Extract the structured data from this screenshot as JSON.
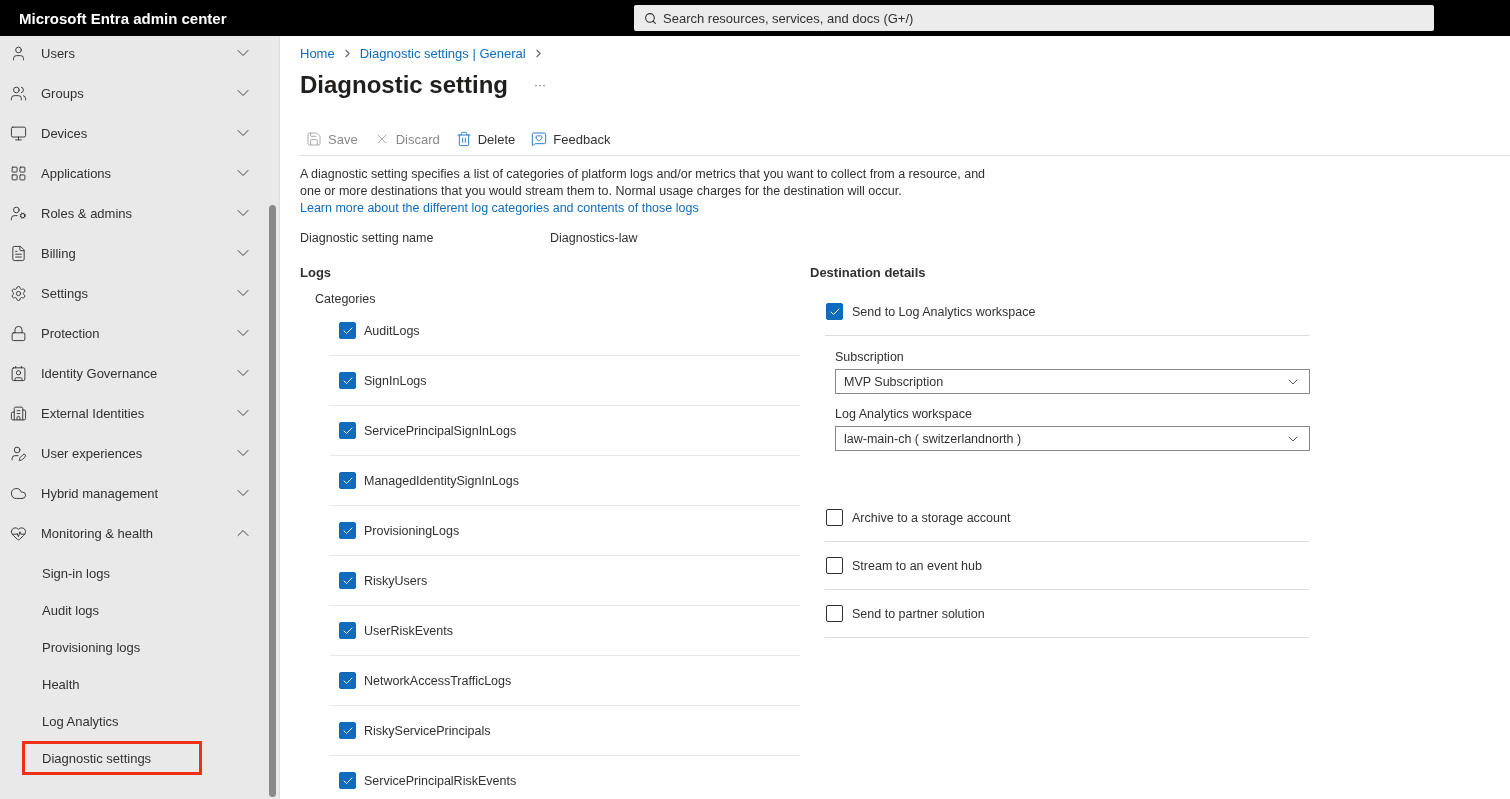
{
  "header": {
    "title": "Microsoft Entra admin center",
    "search": {
      "placeholder": "Search resources, services, and docs (G+/)"
    }
  },
  "sidebar": {
    "items": [
      {
        "label": "Users",
        "expanded": false
      },
      {
        "label": "Groups",
        "expanded": false
      },
      {
        "label": "Devices",
        "expanded": false
      },
      {
        "label": "Applications",
        "expanded": false
      },
      {
        "label": "Roles & admins",
        "expanded": false
      },
      {
        "label": "Billing",
        "expanded": false
      },
      {
        "label": "Settings",
        "expanded": false
      },
      {
        "label": "Protection",
        "expanded": false
      },
      {
        "label": "Identity Governance",
        "expanded": false
      },
      {
        "label": "External Identities",
        "expanded": false
      },
      {
        "label": "User experiences",
        "expanded": false
      },
      {
        "label": "Hybrid management",
        "expanded": false
      },
      {
        "label": "Monitoring & health",
        "expanded": true,
        "children": [
          {
            "label": "Sign-in logs",
            "selected": false
          },
          {
            "label": "Audit logs",
            "selected": false
          },
          {
            "label": "Provisioning logs",
            "selected": false
          },
          {
            "label": "Health",
            "selected": false
          },
          {
            "label": "Log Analytics",
            "selected": false
          },
          {
            "label": "Diagnostic settings",
            "selected": true
          }
        ]
      }
    ]
  },
  "breadcrumb": [
    "Home",
    "Diagnostic settings | General"
  ],
  "page_title": "Diagnostic setting",
  "more": "···",
  "toolbar": [
    {
      "label": "Save",
      "disabled": true
    },
    {
      "label": "Discard",
      "disabled": true
    },
    {
      "label": "Delete",
      "disabled": false
    },
    {
      "label": "Feedback",
      "disabled": false
    }
  ],
  "description": {
    "text": "A diagnostic setting specifies a list of categories of platform logs and/or metrics that you want to collect from a resource, and one or more destinations that you would stream them to. Normal usage charges for the destination will occur.",
    "link": "Learn more about the different log categories and contents of those logs"
  },
  "name_field": {
    "label": "Diagnostic setting name",
    "value": "Diagnostics-law"
  },
  "logs": {
    "title": "Logs",
    "subtitle": "Categories",
    "categories": [
      {
        "label": "AuditLogs",
        "checked": true
      },
      {
        "label": "SignInLogs",
        "checked": true
      },
      {
        "label": "ServicePrincipalSignInLogs",
        "checked": true
      },
      {
        "label": "ManagedIdentitySignInLogs",
        "checked": true
      },
      {
        "label": "ProvisioningLogs",
        "checked": true
      },
      {
        "label": "RiskyUsers",
        "checked": true
      },
      {
        "label": "UserRiskEvents",
        "checked": true
      },
      {
        "label": "NetworkAccessTrafficLogs",
        "checked": true
      },
      {
        "label": "RiskyServicePrincipals",
        "checked": true
      },
      {
        "label": "ServicePrincipalRiskEvents",
        "checked": true
      }
    ]
  },
  "destination": {
    "title": "Destination details",
    "options": [
      {
        "label": "Send to Log Analytics workspace",
        "checked": true,
        "fields": [
          {
            "label": "Subscription",
            "value": "MVP Subscription"
          },
          {
            "label": "Log Analytics workspace",
            "value": "law-main-ch ( switzerlandnorth )"
          }
        ]
      },
      {
        "label": "Archive to a storage account",
        "checked": false
      },
      {
        "label": "Stream to an event hub",
        "checked": false
      },
      {
        "label": "Send to partner solution",
        "checked": false
      }
    ]
  }
}
